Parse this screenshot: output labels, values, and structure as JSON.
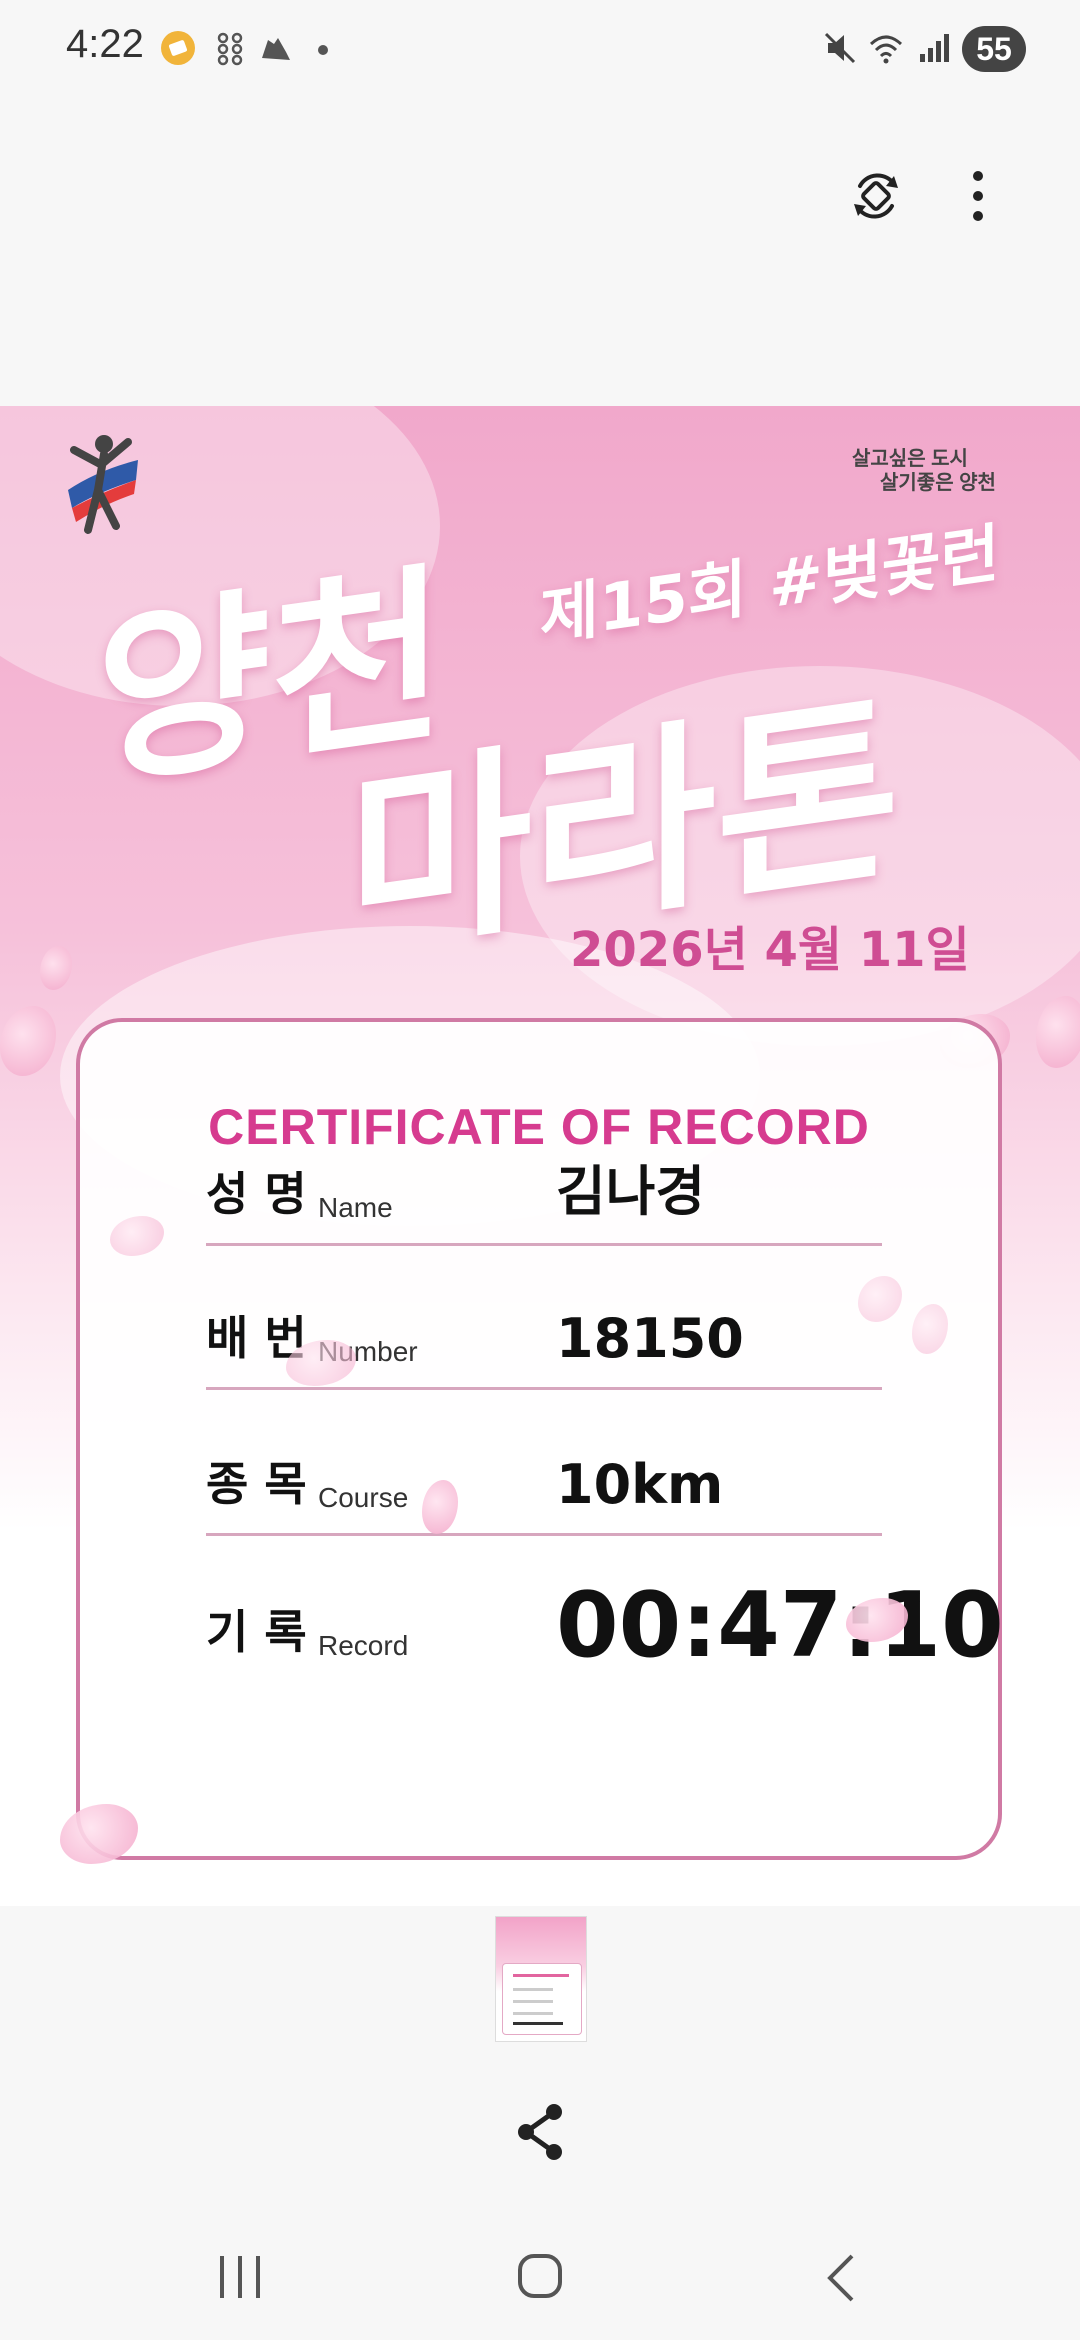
{
  "status_bar": {
    "time": "4:22",
    "battery": "55"
  },
  "certificate": {
    "org_slogan_line1": "살고싶은 도시",
    "org_slogan_line2": "살기좋은 양천",
    "title_big1": "양천",
    "title_big2": "마라톤",
    "edition": "제15회 #벚꽃런",
    "date": "2026년 4월 11일",
    "heading": "CERTIFICATE OF RECORD",
    "rows": [
      {
        "ko": "성명",
        "en": "Name",
        "value": "김나경"
      },
      {
        "ko": "배번",
        "en": "Number",
        "value": "18150"
      },
      {
        "ko": "종목",
        "en": "Course",
        "value": "10km"
      },
      {
        "ko": "기록",
        "en": "Record",
        "value": "00:47:10"
      }
    ]
  },
  "icons": {
    "rotate": "auto-rotate-icon",
    "more": "more-options-icon",
    "share": "share-icon",
    "nav_recent": "recent-apps-icon",
    "nav_home": "home-icon",
    "nav_back": "back-icon"
  },
  "colors": {
    "accent": "#d63b8f",
    "pink_bg": "#f1a8cb",
    "date": "#cf4d93"
  }
}
